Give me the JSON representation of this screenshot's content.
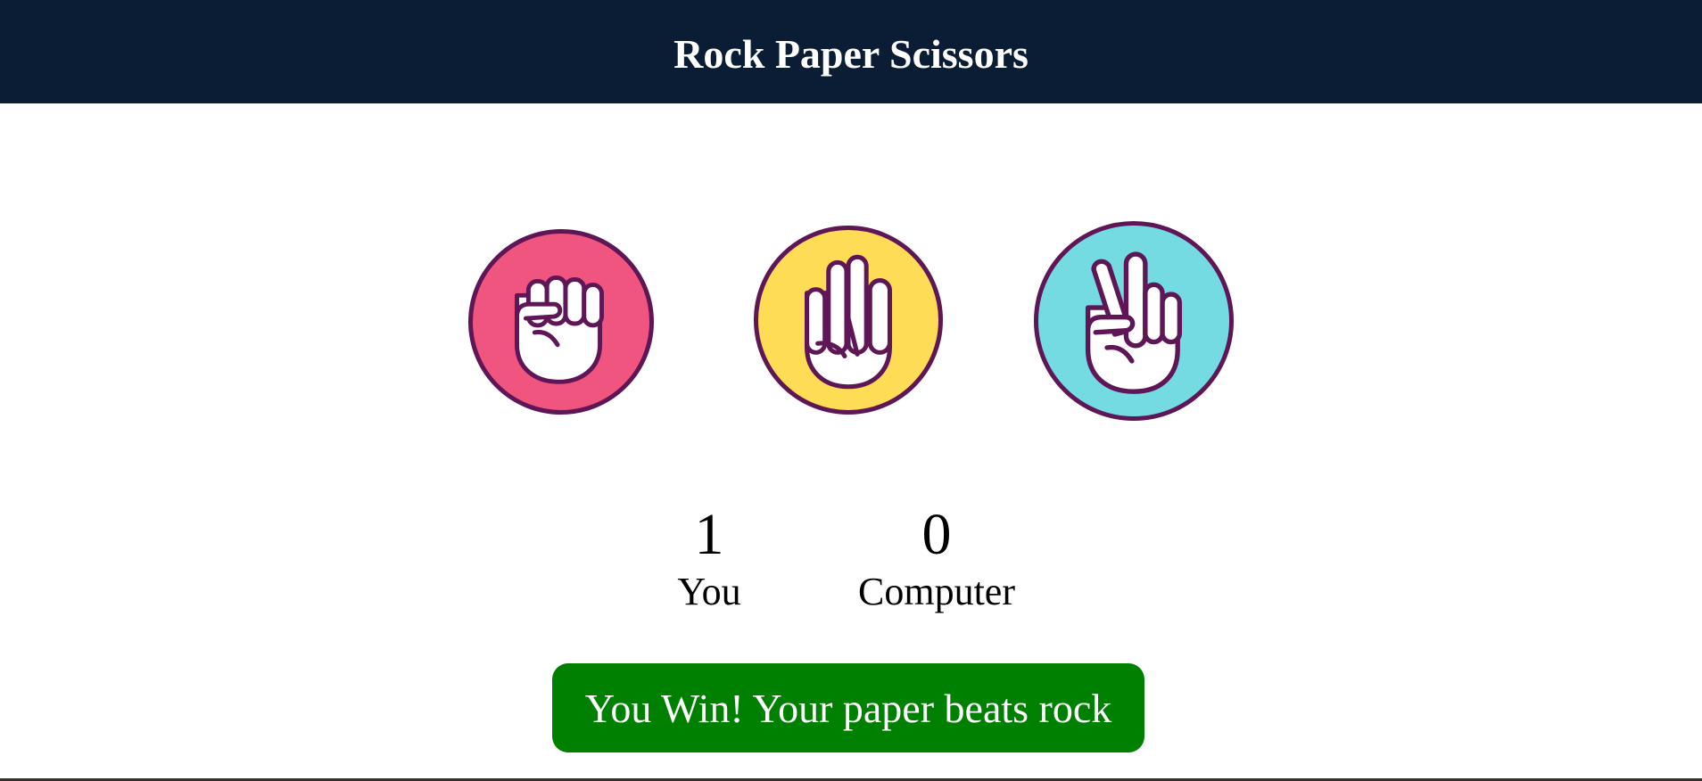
{
  "header": {
    "title": "Rock Paper Scissors"
  },
  "choices": [
    {
      "id": "rock",
      "icon": "rock-hand-icon",
      "color": "#f0557f"
    },
    {
      "id": "paper",
      "icon": "paper-hand-icon",
      "color": "#ffdc55"
    },
    {
      "id": "scissors",
      "icon": "scissors-hand-icon",
      "color": "#75dbe3"
    }
  ],
  "border_color": "#5e1656",
  "scores": {
    "you": {
      "value": "1",
      "label": "You"
    },
    "computer": {
      "value": "0",
      "label": "Computer"
    }
  },
  "result": {
    "text": "You Win! Your paper beats rock",
    "color": "#008000"
  }
}
